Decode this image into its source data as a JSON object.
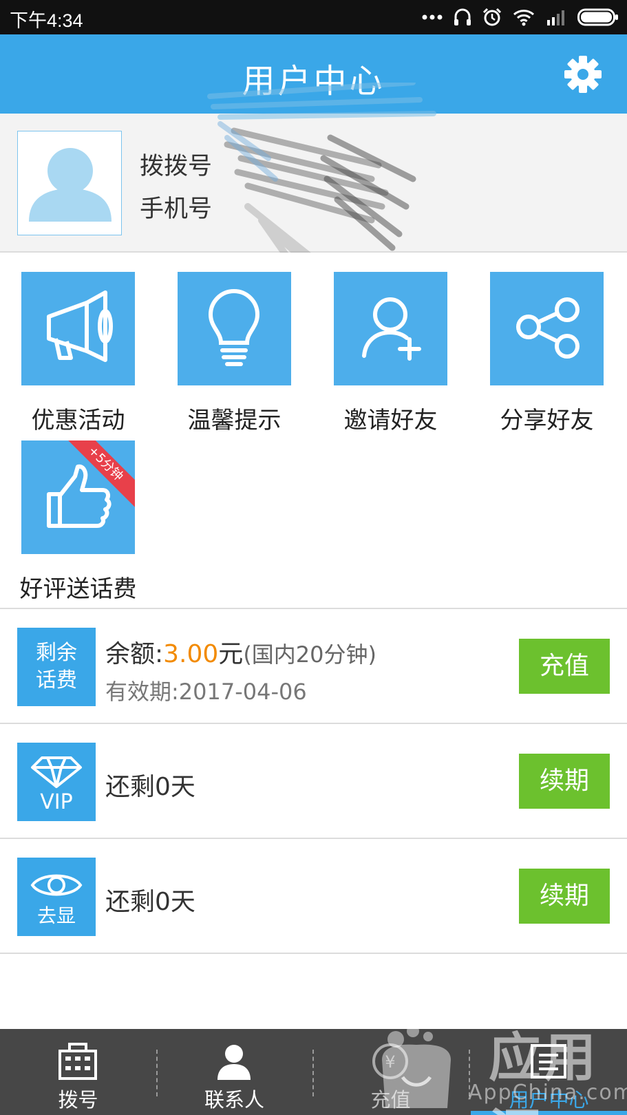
{
  "status_bar": {
    "time": "下午4:34"
  },
  "header": {
    "title": "用户中心"
  },
  "profile": {
    "line1": "拨拨号",
    "line2": "手机号"
  },
  "features": [
    {
      "label": "优惠活动",
      "icon": "megaphone-icon"
    },
    {
      "label": "温馨提示",
      "icon": "lightbulb-icon"
    },
    {
      "label": "邀请好友",
      "icon": "add-user-icon"
    },
    {
      "label": "分享好友",
      "icon": "share-icon"
    },
    {
      "label": "好评送话费",
      "icon": "thumbs-up-icon",
      "badge": "+5分钟"
    }
  ],
  "balance": {
    "icon_line1": "剩余",
    "icon_line2": "话费",
    "label": "余额:",
    "amount": "3.00",
    "unit": "元",
    "detail": "(国内20分钟)",
    "validity": "有效期:2017-04-06",
    "button": "充值"
  },
  "vip": {
    "icon_label": "VIP",
    "remaining": "还剩0天",
    "button": "续期"
  },
  "hide_number": {
    "icon_label": "去显",
    "remaining": "还剩0天",
    "button": "续期"
  },
  "tabs": [
    {
      "label": "拨号",
      "icon": "dialpad-icon"
    },
    {
      "label": "联系人",
      "icon": "contacts-icon"
    },
    {
      "label": "充值",
      "icon": "recharge-icon"
    },
    {
      "label": "用户中心",
      "icon": "user-center-icon",
      "active": true
    }
  ],
  "watermark": {
    "text": "应用汇",
    "sub": "AppChina.com"
  },
  "colors": {
    "primary": "#3aa7e8",
    "tile": "#4daeeb",
    "green": "#6cc12e",
    "orange": "#f28a00",
    "tabbar": "#474747",
    "badge": "#e8404a"
  }
}
